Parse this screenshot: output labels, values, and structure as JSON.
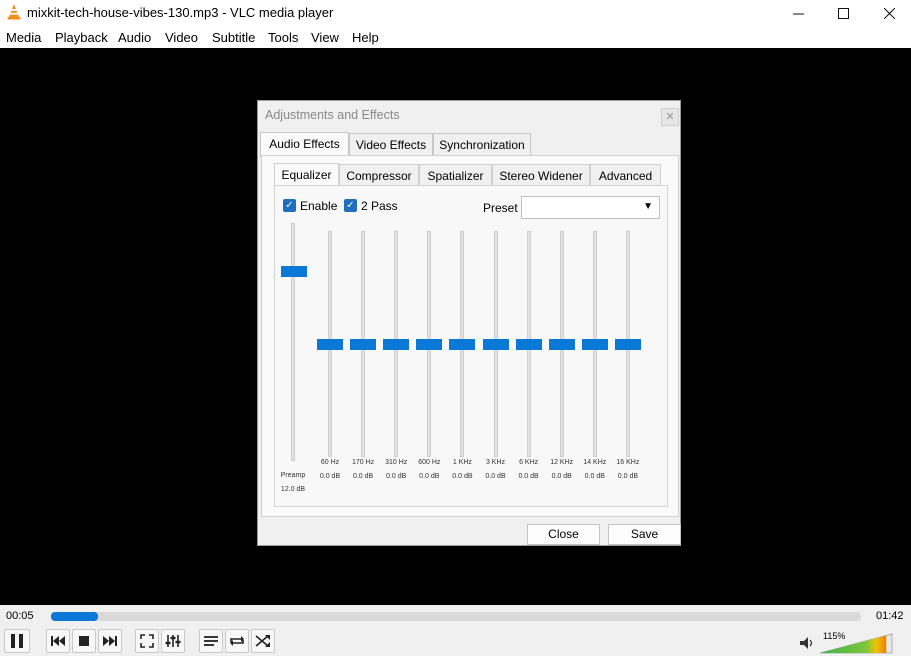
{
  "window": {
    "title": "mixkit-tech-house-vibes-130.mp3 - VLC media player"
  },
  "menu": [
    "Media",
    "Playback",
    "Audio",
    "Video",
    "Subtitle",
    "Tools",
    "View",
    "Help"
  ],
  "dialog": {
    "title": "Adjustments and Effects",
    "tabs": [
      "Audio Effects",
      "Video Effects",
      "Synchronization"
    ],
    "subtabs": [
      "Equalizer",
      "Compressor",
      "Spatializer",
      "Stereo Widener",
      "Advanced"
    ],
    "enable_label": "Enable",
    "enable_checked": true,
    "twopass_label": "2 Pass",
    "twopass_checked": true,
    "preset_label": "Preset",
    "preset_value": "",
    "preamp": {
      "label": "Preamp",
      "value": "12.0 dB",
      "level": 0.8
    },
    "bands": [
      {
        "freq": "60 Hz",
        "value": "0.0 dB",
        "level": 0.5
      },
      {
        "freq": "170 Hz",
        "value": "0.0 dB",
        "level": 0.5
      },
      {
        "freq": "310 Hz",
        "value": "0.0 dB",
        "level": 0.5
      },
      {
        "freq": "600 Hz",
        "value": "0.0 dB",
        "level": 0.5
      },
      {
        "freq": "1 KHz",
        "value": "0.0 dB",
        "level": 0.5
      },
      {
        "freq": "3 KHz",
        "value": "0.0 dB",
        "level": 0.5
      },
      {
        "freq": "6 KHz",
        "value": "0.0 dB",
        "level": 0.5
      },
      {
        "freq": "12 KHz",
        "value": "0.0 dB",
        "level": 0.5
      },
      {
        "freq": "14 KHz",
        "value": "0.0 dB",
        "level": 0.5
      },
      {
        "freq": "16 KHz",
        "value": "0.0 dB",
        "level": 0.5
      }
    ],
    "close_label": "Close",
    "save_label": "Save"
  },
  "player": {
    "elapsed": "00:05",
    "total": "01:42",
    "progress": 0.058,
    "volume": "115%",
    "volume_level": 0.92,
    "accent": "#0a78d7"
  }
}
